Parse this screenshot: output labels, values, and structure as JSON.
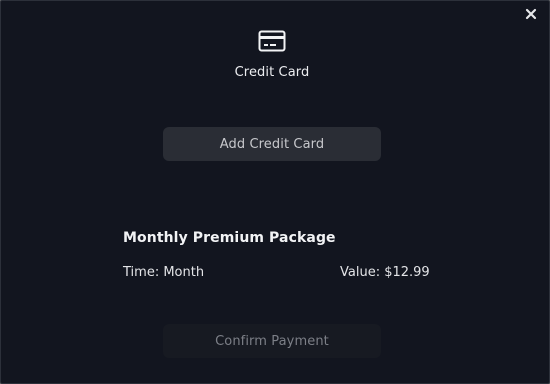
{
  "modal": {
    "close_icon": "close-icon",
    "header_icon": "credit-card-icon",
    "title": "Credit Card"
  },
  "actions": {
    "add_card_label": "Add Credit Card",
    "confirm_label": "Confirm Payment"
  },
  "package": {
    "title": "Monthly Premium Package",
    "time": "Time: Month",
    "value": "Value: $12.99"
  },
  "colors": {
    "background": "#12151f",
    "button_bg": "#2a2d35",
    "disabled_button_bg": "#171a22",
    "text": "#e6e7ea",
    "muted_text": "#7c7f87"
  }
}
